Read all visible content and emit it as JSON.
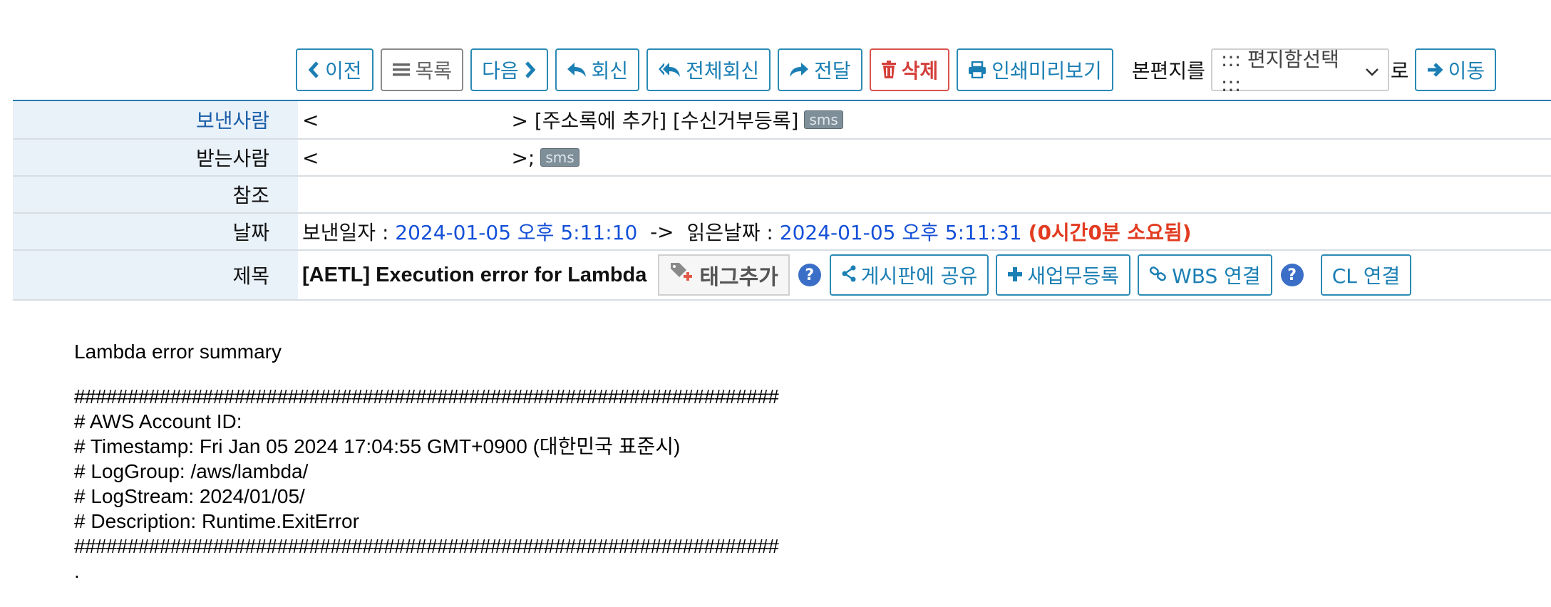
{
  "toolbar": {
    "prev": "이전",
    "list": "목록",
    "next": "다음",
    "reply": "회신",
    "reply_all": "전체회신",
    "forward": "전달",
    "delete": "삭제",
    "print_preview": "인쇄미리보기",
    "move_label": "본편지를",
    "folder_select": "::: 편지함선택 :::",
    "move_suffix": "로",
    "move": "이동"
  },
  "header": {
    "from_label": "보낸사람",
    "from_value_open": "<",
    "from_value_close": "> [주소록에 추가] [수신거부등록]",
    "sms": "sms",
    "to_label": "받는사람",
    "to_value_open": "<",
    "to_value_close": ">;",
    "cc_label": "참조",
    "date_label": "날짜",
    "sent_prefix": "보낸일자 :",
    "sent_value": "2024-01-05 오후 5:11:10",
    "arrow": "->",
    "read_prefix": "읽은날짜 :",
    "read_value": "2024-01-05 오후 5:11:31",
    "elapsed": "(0시간0분 소요됨)",
    "subject_label": "제목",
    "subject": "[AETL] Execution error for Lambda",
    "add_tag": "태그추가",
    "share_board": "게시판에 공유",
    "new_task": "새업무등록",
    "wbs_link": "WBS 연결",
    "cl_link": "CL 연결"
  },
  "body": {
    "summary": "Lambda error summary",
    "hash_line": "##################################################################",
    "account": "# AWS Account ID:",
    "timestamp": "# Timestamp: Fri Jan 05 2024 17:04:55 GMT+0900 (대한민국 표준시)",
    "log_group": "# LogGroup: /aws/lambda/",
    "log_stream": "# LogStream: 2024/01/05/",
    "description": "# Description: Runtime.ExitError",
    "dot": "."
  }
}
